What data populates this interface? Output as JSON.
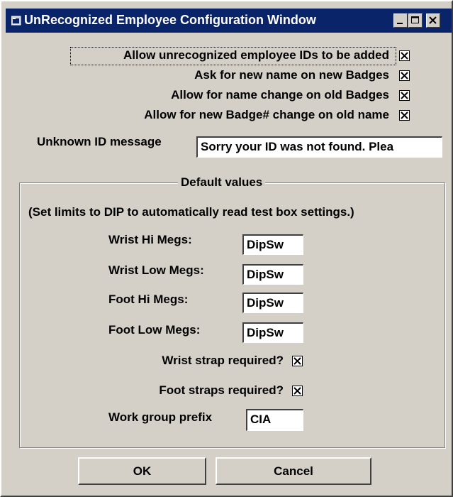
{
  "window": {
    "title": "UnRecognized Employee Configuration Window",
    "controls": {
      "minimize": "_",
      "maximize": "□",
      "close": "✕"
    }
  },
  "options": [
    {
      "label": "Allow unrecognized employee IDs to be added",
      "checked": true
    },
    {
      "label": "Ask for new name on new Badges",
      "checked": true
    },
    {
      "label": "Allow for name change on old Badges",
      "checked": true
    },
    {
      "label": "Allow for new Badge# change on old name",
      "checked": true
    }
  ],
  "unknown_id": {
    "label": "Unknown ID message",
    "value": "Sorry your ID was not found.  Plea"
  },
  "defaults": {
    "group_title": "Default values",
    "hint": "(Set limits to DIP to automatically read test box settings.)",
    "wrist_hi": {
      "label": "Wrist Hi Megs:",
      "value": "DipSw"
    },
    "wrist_low": {
      "label": "Wrist Low Megs:",
      "value": "DipSw"
    },
    "foot_hi": {
      "label": "Foot Hi Megs:",
      "value": "DipSw"
    },
    "foot_low": {
      "label": "Foot Low Megs:",
      "value": "DipSw"
    },
    "wrist_strap": {
      "label": "Wrist strap required?",
      "checked": true
    },
    "foot_straps": {
      "label": "Foot straps required?",
      "checked": true
    },
    "work_group": {
      "label": "Work group prefix",
      "value": "CIA"
    }
  },
  "buttons": {
    "ok": "OK",
    "cancel": "Cancel"
  },
  "colors": {
    "titlebar": "#0a246a",
    "face": "#d4d0c8"
  }
}
